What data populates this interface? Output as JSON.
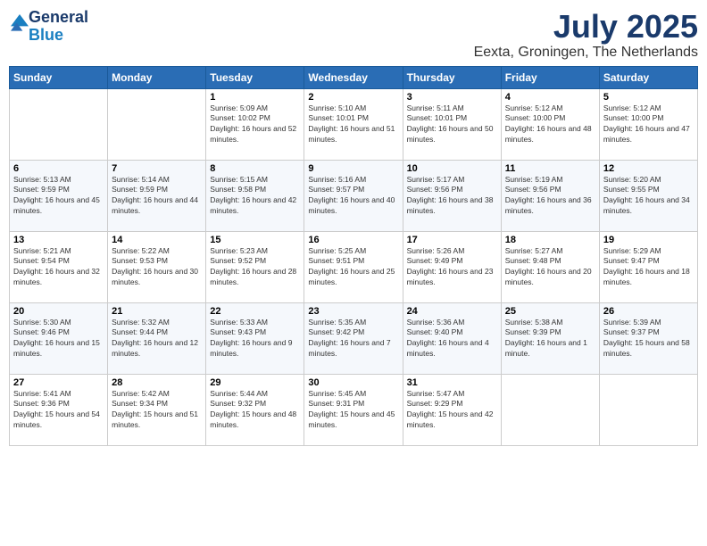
{
  "logo": {
    "general": "General",
    "blue": "Blue"
  },
  "header": {
    "month": "July 2025",
    "location": "Eexta, Groningen, The Netherlands"
  },
  "weekdays": [
    "Sunday",
    "Monday",
    "Tuesday",
    "Wednesday",
    "Thursday",
    "Friday",
    "Saturday"
  ],
  "weeks": [
    [
      {
        "day": "",
        "info": ""
      },
      {
        "day": "",
        "info": ""
      },
      {
        "day": "1",
        "info": "Sunrise: 5:09 AM\nSunset: 10:02 PM\nDaylight: 16 hours and 52 minutes."
      },
      {
        "day": "2",
        "info": "Sunrise: 5:10 AM\nSunset: 10:01 PM\nDaylight: 16 hours and 51 minutes."
      },
      {
        "day": "3",
        "info": "Sunrise: 5:11 AM\nSunset: 10:01 PM\nDaylight: 16 hours and 50 minutes."
      },
      {
        "day": "4",
        "info": "Sunrise: 5:12 AM\nSunset: 10:00 PM\nDaylight: 16 hours and 48 minutes."
      },
      {
        "day": "5",
        "info": "Sunrise: 5:12 AM\nSunset: 10:00 PM\nDaylight: 16 hours and 47 minutes."
      }
    ],
    [
      {
        "day": "6",
        "info": "Sunrise: 5:13 AM\nSunset: 9:59 PM\nDaylight: 16 hours and 45 minutes."
      },
      {
        "day": "7",
        "info": "Sunrise: 5:14 AM\nSunset: 9:59 PM\nDaylight: 16 hours and 44 minutes."
      },
      {
        "day": "8",
        "info": "Sunrise: 5:15 AM\nSunset: 9:58 PM\nDaylight: 16 hours and 42 minutes."
      },
      {
        "day": "9",
        "info": "Sunrise: 5:16 AM\nSunset: 9:57 PM\nDaylight: 16 hours and 40 minutes."
      },
      {
        "day": "10",
        "info": "Sunrise: 5:17 AM\nSunset: 9:56 PM\nDaylight: 16 hours and 38 minutes."
      },
      {
        "day": "11",
        "info": "Sunrise: 5:19 AM\nSunset: 9:56 PM\nDaylight: 16 hours and 36 minutes."
      },
      {
        "day": "12",
        "info": "Sunrise: 5:20 AM\nSunset: 9:55 PM\nDaylight: 16 hours and 34 minutes."
      }
    ],
    [
      {
        "day": "13",
        "info": "Sunrise: 5:21 AM\nSunset: 9:54 PM\nDaylight: 16 hours and 32 minutes."
      },
      {
        "day": "14",
        "info": "Sunrise: 5:22 AM\nSunset: 9:53 PM\nDaylight: 16 hours and 30 minutes."
      },
      {
        "day": "15",
        "info": "Sunrise: 5:23 AM\nSunset: 9:52 PM\nDaylight: 16 hours and 28 minutes."
      },
      {
        "day": "16",
        "info": "Sunrise: 5:25 AM\nSunset: 9:51 PM\nDaylight: 16 hours and 25 minutes."
      },
      {
        "day": "17",
        "info": "Sunrise: 5:26 AM\nSunset: 9:49 PM\nDaylight: 16 hours and 23 minutes."
      },
      {
        "day": "18",
        "info": "Sunrise: 5:27 AM\nSunset: 9:48 PM\nDaylight: 16 hours and 20 minutes."
      },
      {
        "day": "19",
        "info": "Sunrise: 5:29 AM\nSunset: 9:47 PM\nDaylight: 16 hours and 18 minutes."
      }
    ],
    [
      {
        "day": "20",
        "info": "Sunrise: 5:30 AM\nSunset: 9:46 PM\nDaylight: 16 hours and 15 minutes."
      },
      {
        "day": "21",
        "info": "Sunrise: 5:32 AM\nSunset: 9:44 PM\nDaylight: 16 hours and 12 minutes."
      },
      {
        "day": "22",
        "info": "Sunrise: 5:33 AM\nSunset: 9:43 PM\nDaylight: 16 hours and 9 minutes."
      },
      {
        "day": "23",
        "info": "Sunrise: 5:35 AM\nSunset: 9:42 PM\nDaylight: 16 hours and 7 minutes."
      },
      {
        "day": "24",
        "info": "Sunrise: 5:36 AM\nSunset: 9:40 PM\nDaylight: 16 hours and 4 minutes."
      },
      {
        "day": "25",
        "info": "Sunrise: 5:38 AM\nSunset: 9:39 PM\nDaylight: 16 hours and 1 minute."
      },
      {
        "day": "26",
        "info": "Sunrise: 5:39 AM\nSunset: 9:37 PM\nDaylight: 15 hours and 58 minutes."
      }
    ],
    [
      {
        "day": "27",
        "info": "Sunrise: 5:41 AM\nSunset: 9:36 PM\nDaylight: 15 hours and 54 minutes."
      },
      {
        "day": "28",
        "info": "Sunrise: 5:42 AM\nSunset: 9:34 PM\nDaylight: 15 hours and 51 minutes."
      },
      {
        "day": "29",
        "info": "Sunrise: 5:44 AM\nSunset: 9:32 PM\nDaylight: 15 hours and 48 minutes."
      },
      {
        "day": "30",
        "info": "Sunrise: 5:45 AM\nSunset: 9:31 PM\nDaylight: 15 hours and 45 minutes."
      },
      {
        "day": "31",
        "info": "Sunrise: 5:47 AM\nSunset: 9:29 PM\nDaylight: 15 hours and 42 minutes."
      },
      {
        "day": "",
        "info": ""
      },
      {
        "day": "",
        "info": ""
      }
    ]
  ]
}
